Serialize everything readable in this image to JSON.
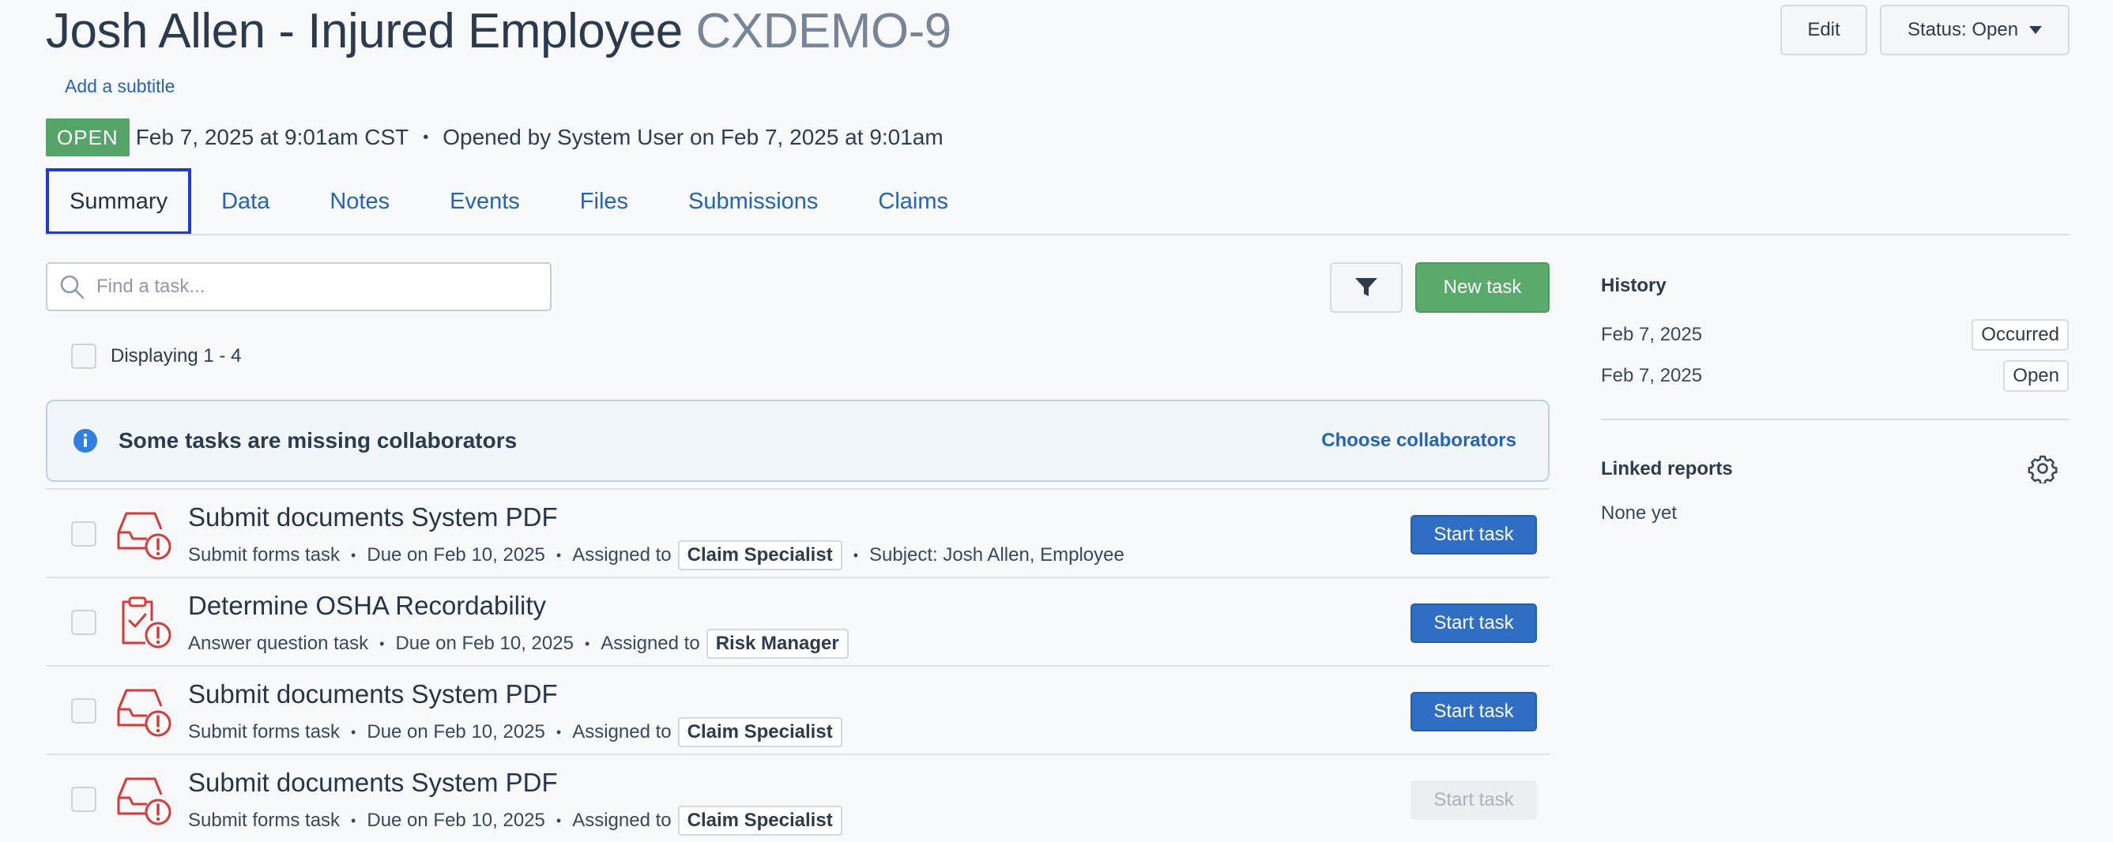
{
  "header": {
    "title": "Josh Allen - Injured Employee",
    "code": "CXDEMO-9",
    "add_subtitle": "Add a subtitle",
    "edit_label": "Edit",
    "status_label": "Status: Open"
  },
  "meta": {
    "badge": "OPEN",
    "timestamp": "Feb 7, 2025 at 9:01am CST",
    "separator": "•",
    "opened_by": "Opened by System User on Feb 7, 2025 at 9:01am"
  },
  "tabs": [
    {
      "label": "Summary",
      "active": true
    },
    {
      "label": "Data"
    },
    {
      "label": "Notes"
    },
    {
      "label": "Events"
    },
    {
      "label": "Files"
    },
    {
      "label": "Submissions"
    },
    {
      "label": "Claims"
    }
  ],
  "toolbar": {
    "search_placeholder": "Find a task...",
    "new_task_label": "New task",
    "display_count": "Displaying 1 - 4"
  },
  "alert": {
    "text": "Some tasks are missing collaborators",
    "link": "Choose collaborators"
  },
  "tasks": [
    {
      "title": "Submit documents System PDF",
      "type": "Submit forms task",
      "due": "Due on Feb 10, 2025",
      "assigned_prefix": "Assigned to",
      "assignee": "Claim Specialist",
      "subject": "Subject: Josh Allen, Employee",
      "button": "Start task",
      "icon": "inbox-alert-icon"
    },
    {
      "title": "Determine OSHA Recordability",
      "type": "Answer question task",
      "due": "Due on Feb 10, 2025",
      "assigned_prefix": "Assigned to",
      "assignee": "Risk Manager",
      "button": "Start task",
      "icon": "clipboard-alert-icon"
    },
    {
      "title": "Submit documents System PDF",
      "type": "Submit forms task",
      "due": "Due on Feb 10, 2025",
      "assigned_prefix": "Assigned to",
      "assignee": "Claim Specialist",
      "button": "Start task",
      "icon": "inbox-alert-icon"
    },
    {
      "title": "Submit documents System PDF",
      "type": "Submit forms task",
      "due": "Due on Feb 10, 2025",
      "assigned_prefix": "Assigned to",
      "assignee": "Claim Specialist",
      "button": "Start task",
      "button_disabled": true,
      "icon": "inbox-alert-icon"
    }
  ],
  "sidebar": {
    "history_title": "History",
    "history": [
      {
        "date": "Feb 7, 2025",
        "event": "Occurred"
      },
      {
        "date": "Feb 7, 2025",
        "event": "Open"
      }
    ],
    "linked_title": "Linked reports",
    "linked_empty": "None yet"
  },
  "colors": {
    "accent": "#2463b6",
    "open_badge": "#54a567",
    "new_task": "#5aaa6b",
    "start_task": "#2e6fc4",
    "task_icon": "#d9393b",
    "active_tab_outline": "#1d3ad8"
  }
}
